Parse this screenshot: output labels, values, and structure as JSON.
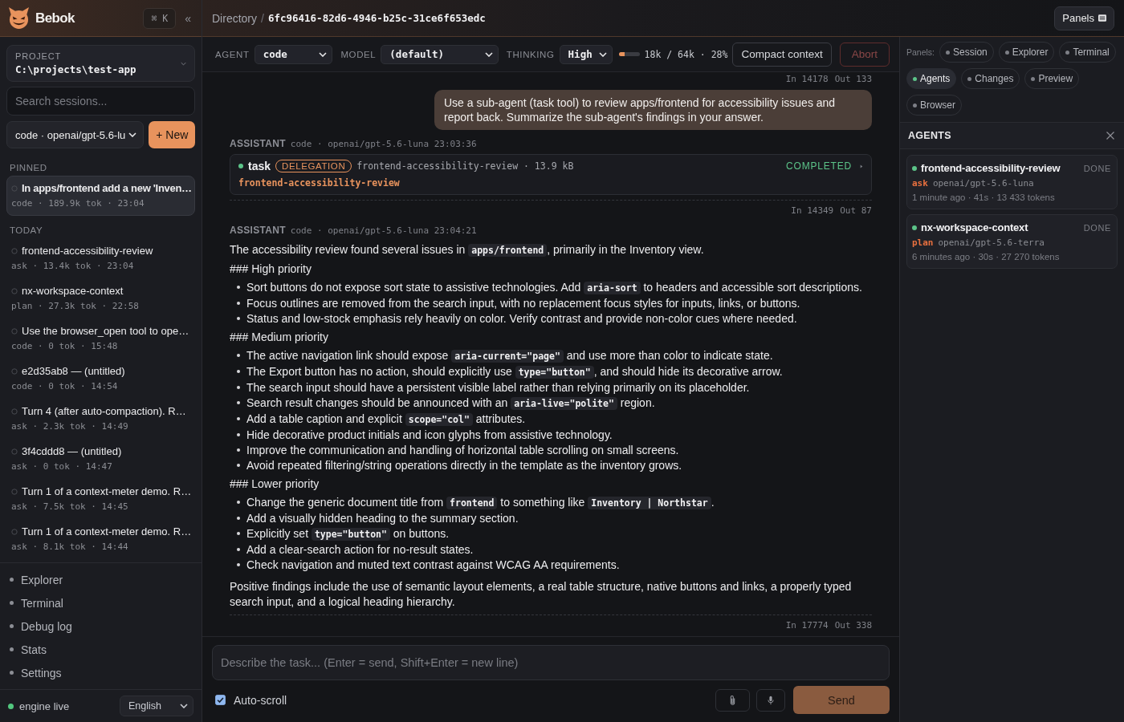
{
  "topbar": {
    "breadcrumb": {
      "parent": "Directory",
      "separator": "/",
      "current": "6fc96416-82d6-4946-b25c-31ce6f653edc"
    },
    "panels_button": "Panels"
  },
  "sidebar": {
    "brand": "Bebok",
    "shortcut": "⌘ K",
    "collapse": "«",
    "project": {
      "label": "PROJECT",
      "path": "C:\\projects\\test-app"
    },
    "search": {
      "placeholder": "Search sessions..."
    },
    "agent_select": "code · openai/gpt-5.6-lu",
    "new_button": "+ New",
    "session_groups": [
      {
        "heading": "PINNED",
        "sessions": [
          {
            "title": "In apps/frontend add a new 'Inven…",
            "meta": "code · 189.9k tok · 23:04",
            "selected": true
          }
        ]
      },
      {
        "heading": "TODAY",
        "sessions": [
          {
            "title": "frontend-accessibility-review",
            "meta": "ask · 13.4k tok · 23:04",
            "selected": false
          },
          {
            "title": "nx-workspace-context",
            "meta": "plan · 27.3k tok · 22:58",
            "selected": false
          },
          {
            "title": "Use the browser_open tool to ope…",
            "meta": "code · 0 tok · 15:48",
            "selected": false
          },
          {
            "title": "e2d35ab8 — (untitled)",
            "meta": "code · 0 tok · 14:54",
            "selected": false
          },
          {
            "title": "Turn 4 (after auto-compaction). R…",
            "meta": "ask · 2.3k tok · 14:49",
            "selected": false
          },
          {
            "title": "3f4cddd8 — (untitled)",
            "meta": "ask · 0 tok · 14:47",
            "selected": false
          },
          {
            "title": "Turn 1 of a context-meter demo. R…",
            "meta": "ask · 7.5k tok · 14:45",
            "selected": false
          },
          {
            "title": "Turn 1 of a context-meter demo. R…",
            "meta": "ask · 8.1k tok · 14:44",
            "selected": false
          }
        ]
      }
    ],
    "nav": [
      "Explorer",
      "Terminal",
      "Debug log",
      "Stats",
      "Settings"
    ],
    "footer": {
      "status": "engine live",
      "language": "English"
    }
  },
  "agent_bar": {
    "selectors": [
      {
        "label": "AGENT",
        "value": "code"
      },
      {
        "label": "MODEL",
        "value": "(default)"
      },
      {
        "label": "THINKING",
        "value": "High"
      }
    ],
    "context": {
      "level": 0.28,
      "reading": "18k / 64k · 28%"
    },
    "compact_button": "Compact context",
    "abort_button": {
      "label": "Abort",
      "disabled": true
    }
  },
  "messages": [
    {
      "kind": "usage",
      "in": "In 14178",
      "out": "Out 133"
    },
    {
      "kind": "user",
      "text": "Use a sub-agent (task tool) to review apps/frontend for accessibility issues and report back. Summarize the sub-agent's findings in your answer."
    },
    {
      "kind": "assistant",
      "role": "ASSISTANT",
      "meta": "code · openai/gpt-5.6-luna 23:03:36",
      "blocks": [
        {
          "kind": "tool",
          "name": "task",
          "badge": "DELEGATION",
          "details": "frontend-accessibility-review · 13.9 kB",
          "status": "COMPLETED",
          "expanded": false,
          "target": "frontend-accessibility-review"
        }
      ],
      "usage": {
        "in": "In 14349",
        "out": "Out 87"
      }
    },
    {
      "kind": "assistant",
      "role": "ASSISTANT",
      "meta": "code · openai/gpt-5.6-luna 23:04:21",
      "blocks": [
        {
          "kind": "paragraph",
          "parts": [
            {
              "kind": "text",
              "text": "The accessibility review found several issues in "
            },
            {
              "kind": "code",
              "text": "apps/frontend"
            },
            {
              "kind": "text",
              "text": ", primarily in the Inventory view."
            }
          ]
        },
        {
          "kind": "heading",
          "text": "### High priority"
        },
        {
          "kind": "list",
          "items": [
            {
              "parts": [
                {
                  "kind": "text",
                  "text": "Sort buttons do not expose sort state to assistive technologies. Add "
                },
                {
                  "kind": "code",
                  "text": "aria-sort"
                },
                {
                  "kind": "text",
                  "text": " to headers and accessible sort descriptions."
                }
              ]
            },
            {
              "parts": [
                {
                  "kind": "text",
                  "text": "Focus outlines are removed from the search input, with no replacement focus styles for inputs, links, or buttons."
                }
              ]
            },
            {
              "parts": [
                {
                  "kind": "text",
                  "text": "Status and low-stock emphasis rely heavily on color. Verify contrast and provide non-color cues where needed."
                }
              ]
            }
          ]
        },
        {
          "kind": "heading",
          "text": "### Medium priority"
        },
        {
          "kind": "list",
          "items": [
            {
              "parts": [
                {
                  "kind": "text",
                  "text": "The active navigation link should expose "
                },
                {
                  "kind": "code",
                  "text": "aria-current=\"page\""
                },
                {
                  "kind": "text",
                  "text": " and use more than color to indicate state."
                }
              ]
            },
            {
              "parts": [
                {
                  "kind": "text",
                  "text": "The Export button has no action, should explicitly use "
                },
                {
                  "kind": "code",
                  "text": "type=\"button\""
                },
                {
                  "kind": "text",
                  "text": ", and should hide its decorative arrow."
                }
              ]
            },
            {
              "parts": [
                {
                  "kind": "text",
                  "text": "The search input should have a persistent visible label rather than relying primarily on its placeholder."
                }
              ]
            },
            {
              "parts": [
                {
                  "kind": "text",
                  "text": "Search result changes should be announced with an "
                },
                {
                  "kind": "code",
                  "text": "aria-live=\"polite\""
                },
                {
                  "kind": "text",
                  "text": " region."
                }
              ]
            },
            {
              "parts": [
                {
                  "kind": "text",
                  "text": "Add a table caption and explicit "
                },
                {
                  "kind": "code",
                  "text": "scope=\"col\""
                },
                {
                  "kind": "text",
                  "text": " attributes."
                }
              ]
            },
            {
              "parts": [
                {
                  "kind": "text",
                  "text": "Hide decorative product initials and icon glyphs from assistive technology."
                }
              ]
            },
            {
              "parts": [
                {
                  "kind": "text",
                  "text": "Improve the communication and handling of horizontal table scrolling on small screens."
                }
              ]
            },
            {
              "parts": [
                {
                  "kind": "text",
                  "text": "Avoid repeated filtering/string operations directly in the template as the inventory grows."
                }
              ]
            }
          ]
        },
        {
          "kind": "heading",
          "text": "### Lower priority"
        },
        {
          "kind": "list",
          "items": [
            {
              "parts": [
                {
                  "kind": "text",
                  "text": "Change the generic document title from "
                },
                {
                  "kind": "code",
                  "text": "frontend"
                },
                {
                  "kind": "text",
                  "text": " to something like "
                },
                {
                  "kind": "code",
                  "text": "Inventory | Northstar"
                },
                {
                  "kind": "text",
                  "text": "."
                }
              ]
            },
            {
              "parts": [
                {
                  "kind": "text",
                  "text": "Add a visually hidden heading to the summary section."
                }
              ]
            },
            {
              "parts": [
                {
                  "kind": "text",
                  "text": "Explicitly set "
                },
                {
                  "kind": "code",
                  "text": "type=\"button\""
                },
                {
                  "kind": "text",
                  "text": " on buttons."
                }
              ]
            },
            {
              "parts": [
                {
                  "kind": "text",
                  "text": "Add a clear-search action for no-result states."
                }
              ]
            },
            {
              "parts": [
                {
                  "kind": "text",
                  "text": "Check navigation and muted text contrast against WCAG AA requirements."
                }
              ]
            }
          ]
        },
        {
          "kind": "paragraph",
          "parts": [
            {
              "kind": "text",
              "text": "Positive findings include the use of semantic layout elements, a real table structure, native buttons and links, a properly typed search input, and a logical heading hierarchy."
            }
          ]
        }
      ],
      "usage": {
        "in": "In 17774",
        "out": "Out 338"
      }
    }
  ],
  "composer": {
    "placeholder": "Describe the task... (Enter = send, Shift+Enter = new line)",
    "auto_scroll": {
      "label": "Auto-scroll",
      "checked": true
    },
    "send_button": {
      "label": "Send",
      "disabled": true
    }
  },
  "right_panel": {
    "panels_label": "Panels:",
    "panels": [
      {
        "label": "Session",
        "selected": false
      },
      {
        "label": "Explorer",
        "selected": false
      },
      {
        "label": "Terminal",
        "selected": false
      },
      {
        "label": "Agents",
        "selected": true
      },
      {
        "label": "Changes",
        "selected": false
      },
      {
        "label": "Preview",
        "selected": false
      },
      {
        "label": "Browser",
        "selected": false
      }
    ],
    "agents": {
      "heading": "AGENTS",
      "items": [
        {
          "name": "frontend-accessibility-review",
          "status": "DONE",
          "mode": "ask",
          "model": "openai/gpt-5.6-luna",
          "stats": "1 minute ago · 41s · 13 433 tokens"
        },
        {
          "name": "nx-workspace-context",
          "status": "DONE",
          "mode": "plan",
          "model": "openai/gpt-5.6-terra",
          "stats": "6 minutes ago · 30s · 27 270 tokens"
        }
      ]
    }
  }
}
